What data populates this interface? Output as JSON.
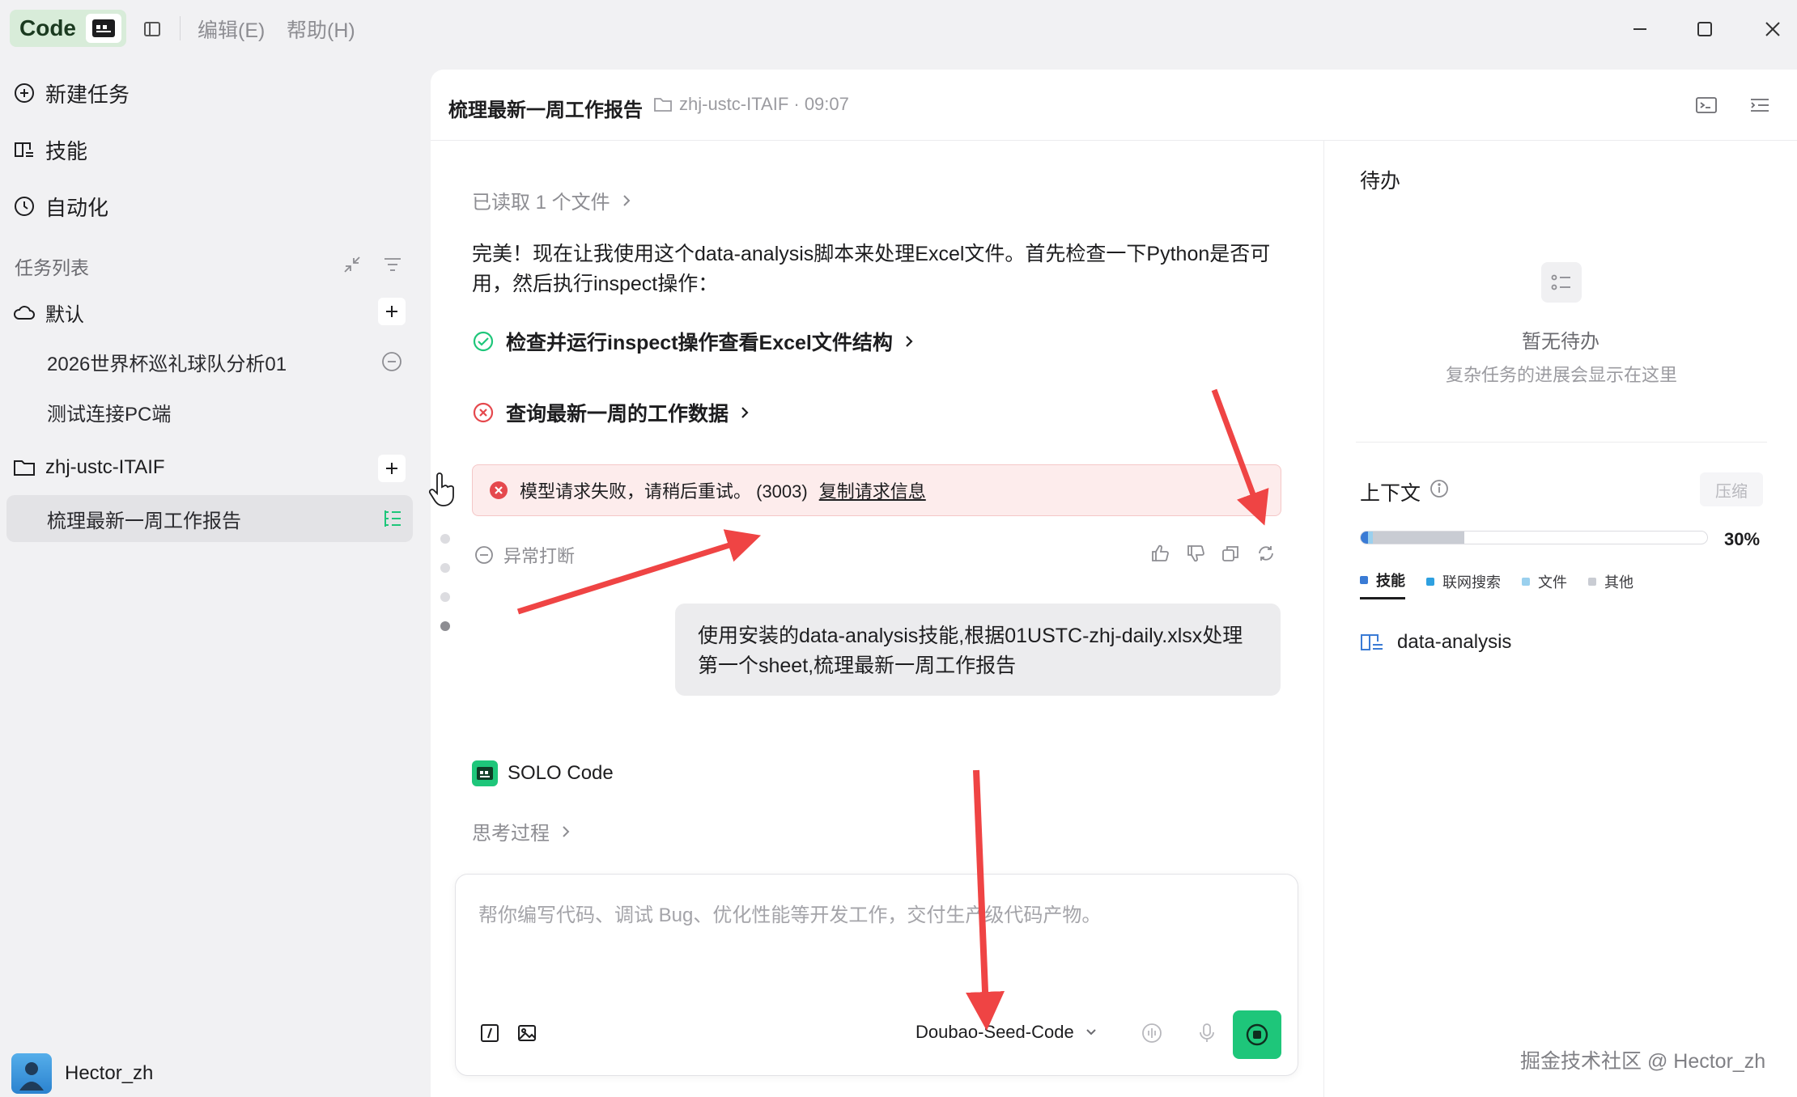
{
  "titlebar": {
    "app_name": "Code",
    "menus": [
      "编辑(E)",
      "帮助(H)"
    ]
  },
  "sidebar": {
    "nav": [
      {
        "icon": "new-task-icon",
        "label": "新建任务"
      },
      {
        "icon": "skills-book-icon",
        "label": "技能"
      },
      {
        "icon": "clock-icon",
        "label": "自动化"
      }
    ],
    "section_title": "任务列表",
    "groups": [
      {
        "icon": "cloud-icon",
        "label": "默认",
        "tasks": [
          "2026世界杯巡礼球队分析01",
          "测试连接PC端"
        ]
      },
      {
        "icon": "folder-icon",
        "label": "zhj-ustc-ITAIF",
        "tasks": [
          "梳理最新一周工作报告"
        ]
      }
    ],
    "user": "Hector_zh"
  },
  "conversation": {
    "title": "梳理最新一周工作报告",
    "folder_meta": "zhj-ustc-ITAIF · 09:07",
    "read_files": "已读取 1 个文件",
    "paragraph": "完美！现在让我使用这个data-analysis脚本来处理Excel文件。首先检查一下Python是否可用，然后执行inspect操作：",
    "step_ok": "检查并运行inspect操作查看Excel文件结构",
    "step_fail": "查询最新一周的工作数据",
    "error_text": "模型请求失败，请稍后重试。 (3003)",
    "error_link": "复制请求信息",
    "interrupted": "异常打断",
    "user_message": "使用安装的data-analysis技能,根据01USTC-zhj-daily.xlsx处理第一个sheet,梳理最新一周工作报告",
    "agent_name": "SOLO Code",
    "thinking": "思考过程"
  },
  "composer": {
    "placeholder": "帮你编写代码、调试 Bug、优化性能等开发工作，交付生产级代码产物。",
    "model": "Doubao-Seed-Code"
  },
  "right_panel": {
    "todo_title": "待办",
    "todo_empty_title": "暂无待办",
    "todo_empty_desc": "复杂任务的进展会显示在这里",
    "context_title": "上下文",
    "compress_label": "压缩",
    "context_percent": "30%",
    "context_fraction": 0.3,
    "legend": [
      {
        "label": "技能",
        "color": "#3a7bd5"
      },
      {
        "label": "联网搜索",
        "color": "#2ea0e0"
      },
      {
        "label": "文件",
        "color": "#9ad0ee"
      },
      {
        "label": "其他",
        "color": "#c9ccd3"
      }
    ],
    "skill_name": "data-analysis"
  },
  "watermark": "掘金技术社区 @ Hector_zh",
  "colors": {
    "accent_green": "#1ec67a",
    "error_red": "#e5484d",
    "annotation_red": "#ef4444"
  }
}
